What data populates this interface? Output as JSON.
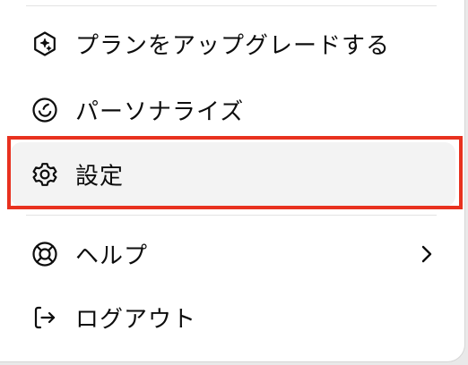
{
  "menu": {
    "items": [
      {
        "label": "プランをアップグレードする",
        "icon": "upgrade-sparkle-icon"
      },
      {
        "label": "パーソナライズ",
        "icon": "personalize-icon"
      },
      {
        "label": "設定",
        "icon": "settings-gear-icon",
        "selected": true
      },
      {
        "label": "ヘルプ",
        "icon": "help-lifebuoy-icon",
        "has_submenu": true,
        "submenu_icon": "chevron-right-icon"
      },
      {
        "label": "ログアウト",
        "icon": "logout-icon"
      }
    ]
  },
  "colors": {
    "text": "#0d0d0d",
    "selected_background": "#f3f3f3",
    "highlight_border": "#e8311f",
    "divider": "#e3e3e3"
  }
}
